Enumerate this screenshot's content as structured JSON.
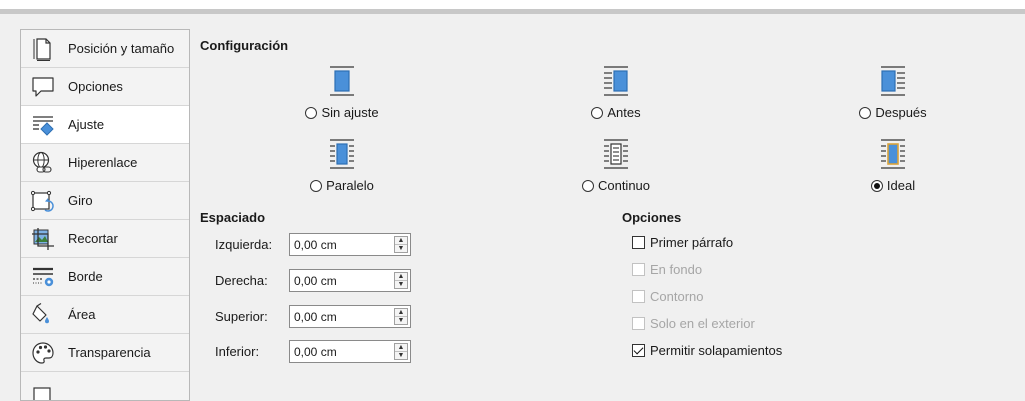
{
  "sidebar": {
    "items": [
      {
        "label": "Posición y tamaño",
        "icon": "position-size-icon",
        "selected": false
      },
      {
        "label": "Opciones",
        "icon": "speech-bubble-icon",
        "selected": false
      },
      {
        "label": "Ajuste",
        "icon": "wrap-icon",
        "selected": true
      },
      {
        "label": "Hiperenlace",
        "icon": "hyperlink-globe-icon",
        "selected": false
      },
      {
        "label": "Giro",
        "icon": "rotate-icon",
        "selected": false
      },
      {
        "label": "Recortar",
        "icon": "crop-icon",
        "selected": false
      },
      {
        "label": "Borde",
        "icon": "border-icon",
        "selected": false
      },
      {
        "label": "Área",
        "icon": "area-fill-icon",
        "selected": false
      },
      {
        "label": "Transparencia",
        "icon": "palette-icon",
        "selected": false
      }
    ]
  },
  "configuracion": {
    "title": "Configuración",
    "options": [
      {
        "label": "Sin ajuste",
        "selected": false
      },
      {
        "label": "Antes",
        "selected": false
      },
      {
        "label": "Después",
        "selected": false
      },
      {
        "label": "Paralelo",
        "selected": false
      },
      {
        "label": "Continuo",
        "selected": false
      },
      {
        "label": "Ideal",
        "selected": true
      }
    ]
  },
  "espaciado": {
    "title": "Espaciado",
    "fields": [
      {
        "label": "Izquierda:",
        "value": "0,00 cm"
      },
      {
        "label": "Derecha:",
        "value": "0,00 cm"
      },
      {
        "label": "Superior:",
        "value": "0,00 cm"
      },
      {
        "label": "Inferior:",
        "value": "0,00 cm"
      }
    ]
  },
  "opciones": {
    "title": "Opciones",
    "checkboxes": [
      {
        "label": "Primer párrafo",
        "checked": false,
        "enabled": true
      },
      {
        "label": "En fondo",
        "checked": false,
        "enabled": false
      },
      {
        "label": "Contorno",
        "checked": false,
        "enabled": false
      },
      {
        "label": "Solo en el exterior",
        "checked": false,
        "enabled": false
      },
      {
        "label": "Permitir solapamientos",
        "checked": true,
        "enabled": true
      }
    ]
  },
  "colors": {
    "accent_blue": "#4a90d9",
    "selected_bg": "#ffffff",
    "disabled_text": "#a6a6a6"
  }
}
